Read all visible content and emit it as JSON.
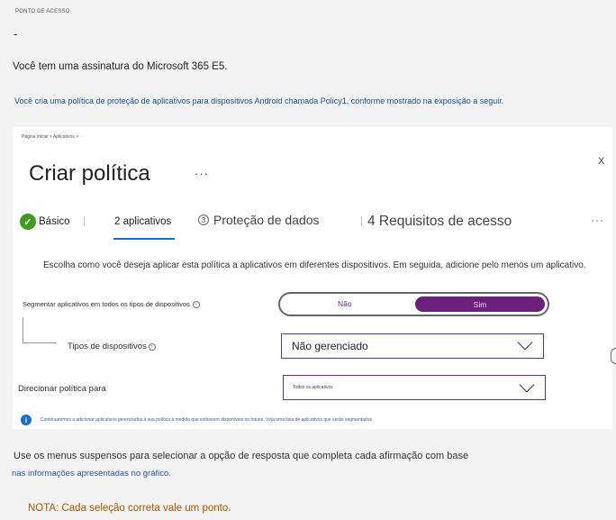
{
  "header": {
    "section_tag": "PONTO DE ACESSO",
    "dash": "-",
    "intro": "Você tem uma assinatura do Microsoft 365 E5.",
    "scenario": "Você cria uma política de proteção de aplicativos para dispositivos Android chamada Policy1, conforme mostrado na exposição a seguir."
  },
  "panel": {
    "breadcrumb": "Página inicial > Aplicativos > ·",
    "title": "Criar política",
    "more": "···",
    "close": "X",
    "steps": [
      {
        "label": "Básico",
        "state": "complete",
        "icon": "check-icon"
      },
      {
        "label": "2 aplicativos",
        "state": "active"
      },
      {
        "number": "3",
        "label": "Proteção de dados",
        "state": "pending"
      },
      {
        "label": "4 Requisitos de acesso",
        "state": "pending"
      }
    ],
    "steps_more": "···",
    "instructions": "Escolha como você deseja aplicar esta política a aplicativos em diferentes dispositivos. Em seguida, adicione pelo menos um aplicativo.",
    "segment": {
      "label": "Segmentar aplicativos em todos os tipos de dispositivos",
      "info": "i",
      "option_no": "Não",
      "option_yes": "Sim",
      "selected": "Sim"
    },
    "device_types": {
      "label": "Tipos de dispositivos",
      "info": "i",
      "value": "Não gerenciado"
    },
    "target": {
      "label": "Direcionar política para",
      "value": "Todos os aplicativos"
    },
    "info_note": "Continuaremos a adicionar aplicativos gerenciados à sua política à medida que estiverem disponíveis no Intune. Veja uma lista de aplicativos que serão segmentados"
  },
  "question": {
    "line1": "Use os menus suspensos para selecionar a opção de resposta que completa cada afirmação com base",
    "line2": "nas informações apresentadas no gráfico.",
    "note": "NOTA: Cada seleção correta vale um ponto."
  },
  "colors": {
    "accent_purple": "#6d1f7c",
    "link_blue": "#1a6fc4",
    "success_green": "#3f9a1f",
    "note_orange": "#b35400"
  }
}
